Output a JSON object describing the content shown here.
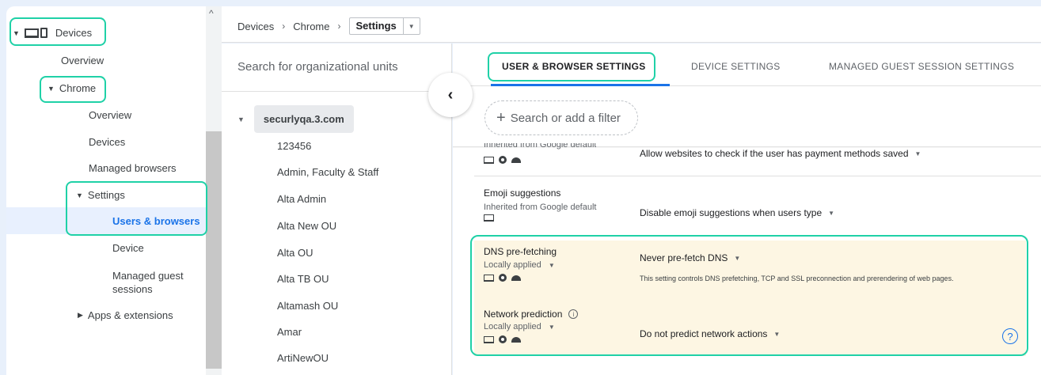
{
  "nav": {
    "devices": "Devices",
    "overview": "Overview",
    "chrome": "Chrome",
    "chrome_overview": "Overview",
    "chrome_devices": "Devices",
    "managed_browsers": "Managed browsers",
    "settings": "Settings",
    "users_browsers": "Users & browsers",
    "device": "Device",
    "managed_guest_1": "Managed guest",
    "managed_guest_2": "sessions",
    "apps_extensions": "Apps & extensions"
  },
  "breadcrumb": {
    "items": [
      "Devices",
      "Chrome"
    ],
    "current": "Settings"
  },
  "org": {
    "search_placeholder": "Search for organizational units",
    "root": "securlyqa.3.com",
    "units": [
      "123456",
      "Admin, Faculty & Staff",
      "Alta Admin",
      "Alta New OU",
      "Alta OU",
      "Alta TB OU",
      "Altamash OU",
      "Amar",
      "ArtiNewOU"
    ]
  },
  "tabs": [
    "USER & BROWSER SETTINGS",
    "DEVICE SETTINGS",
    "MANAGED GUEST SESSION SETTINGS"
  ],
  "filter": {
    "label": "Search or add a filter"
  },
  "settings": {
    "partial": {
      "sub": "Inherited from Google default",
      "value": "Allow websites to check if the user has payment methods saved"
    },
    "emoji": {
      "name": "Emoji suggestions",
      "sub": "Inherited from Google default",
      "value": "Disable emoji suggestions when users type"
    },
    "dns": {
      "name": "DNS pre-fetching",
      "sub": "Locally applied",
      "value": "Never pre-fetch DNS",
      "desc": "This setting controls DNS prefetching, TCP and SSL preconnection and prerendering of web pages."
    },
    "network": {
      "name": "Network prediction",
      "sub": "Locally applied",
      "value": "Do not predict network actions"
    }
  },
  "colors": {
    "highlight_outline": "#1fd1a7",
    "accent": "#1a73e8",
    "selected_bg": "#e8f0fe",
    "highlight_bg": "#fdf6e3"
  },
  "icons": [
    "devices-icon",
    "collapse-chevron-icon",
    "plus-icon",
    "laptop-icon",
    "chrome-icon",
    "android-icon",
    "info-icon",
    "help-icon"
  ]
}
